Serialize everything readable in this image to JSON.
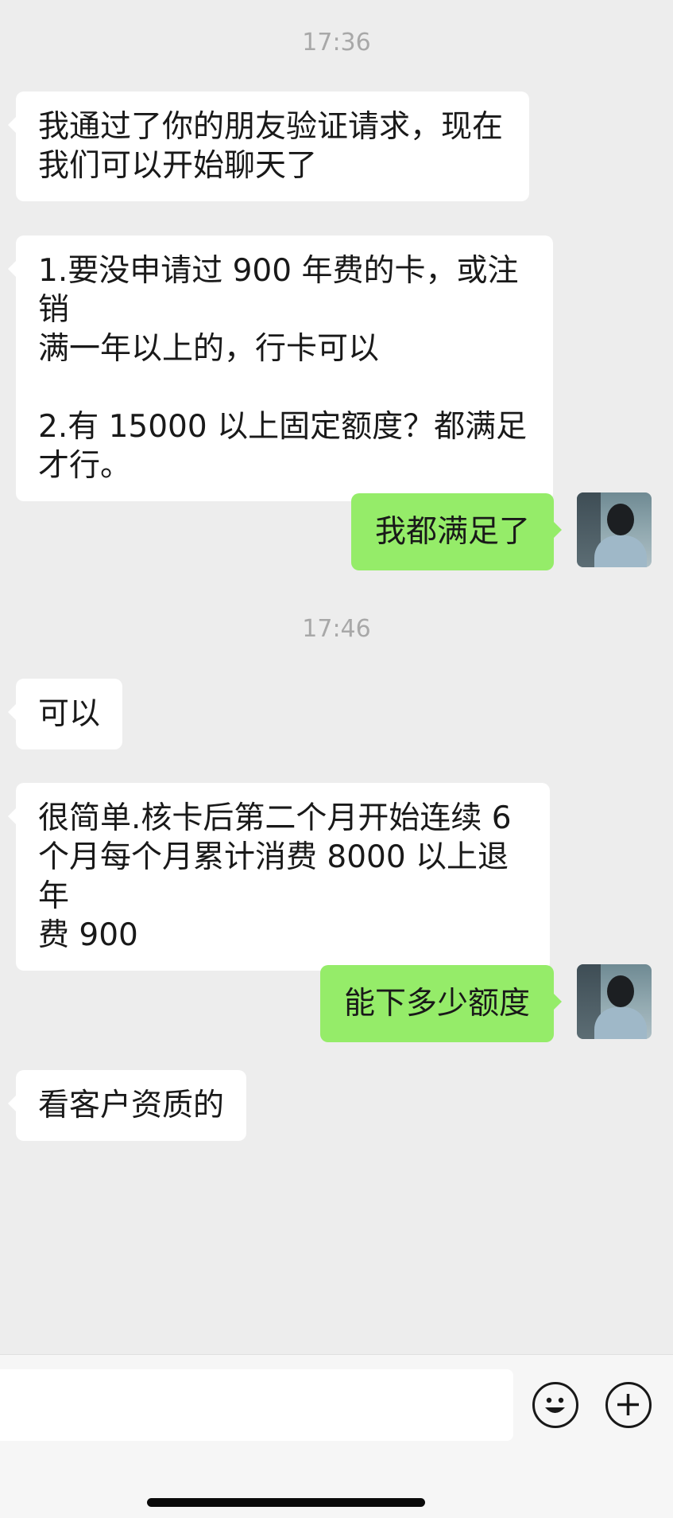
{
  "messages": [
    {
      "kind": "time",
      "text": "17:36"
    },
    {
      "kind": "in",
      "text": "我通过了你的朋友验证请求，现在\n我们可以开始聊天了"
    },
    {
      "kind": "in",
      "text": "1.要没申请过 900 年费的卡，或注销\n满一年以上的，行卡可以\n\n2.有 15000 以上固定额度？都满足\n才行。"
    },
    {
      "kind": "out",
      "text": "我都满足了"
    },
    {
      "kind": "time",
      "text": "17:46"
    },
    {
      "kind": "in",
      "text": "可以"
    },
    {
      "kind": "in",
      "text": "很简单.核卡后第二个月开始连续 6\n个月每个月累计消费 8000 以上退年\n费 900"
    },
    {
      "kind": "out",
      "text": "能下多少额度"
    },
    {
      "kind": "in",
      "text": "看客户资质的"
    }
  ],
  "input_bar": {
    "message_input_value": "",
    "emoji_button_icon": "smiley-face-icon",
    "more_button_icon": "plus-circle-icon"
  },
  "colors": {
    "background": "#ededed",
    "incoming_bubble": "#ffffff",
    "outgoing_bubble": "#95ec69",
    "timestamp_text": "#a8a8a8"
  }
}
